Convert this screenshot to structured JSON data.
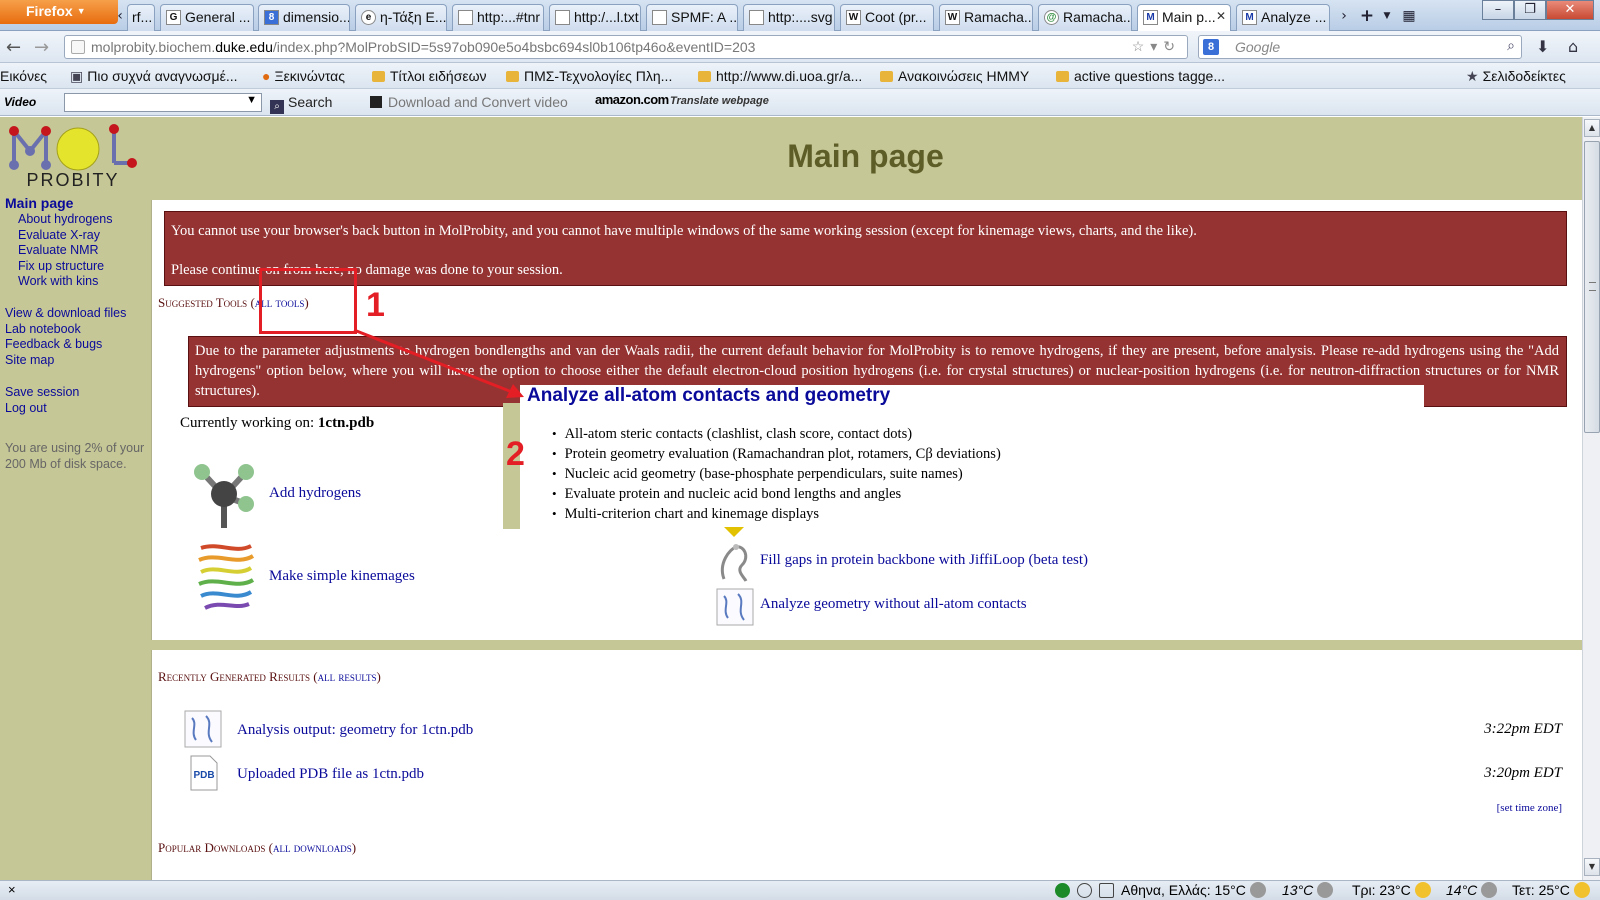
{
  "browser": {
    "app_button": "Firefox",
    "tabs": [
      {
        "label": "rf...",
        "icon": "K"
      },
      {
        "label": "General ...",
        "icon": "G"
      },
      {
        "label": "dimensio...",
        "icon": "8"
      },
      {
        "label": "η-Τάξη Ε...",
        "icon": "e"
      },
      {
        "label": "http:...#tnr",
        "icon": ""
      },
      {
        "label": "http:/...l.txt",
        "icon": ""
      },
      {
        "label": "SPMF: A ...",
        "icon": ""
      },
      {
        "label": "http:....svg",
        "icon": ""
      },
      {
        "label": "Coot (pr...",
        "icon": "W"
      },
      {
        "label": "Ramacha...",
        "icon": "W"
      },
      {
        "label": "Ramacha...",
        "icon": "@"
      },
      {
        "label": "Main p...",
        "icon": "M"
      },
      {
        "label": "Analyze ...",
        "icon": "M"
      }
    ],
    "new_tab": "+",
    "url_prefix": "molprobity.biochem.",
    "url_domain": "duke.edu",
    "url_suffix": "/index.php?MolProbSID=5s97ob090e5o4bsbc694sl0b106tp46o&eventID=203",
    "search_placeholder": "Google",
    "search_engine_icon": "8",
    "bookmarks": [
      "Εικόνες",
      "Πιο συχνά αναγνωσμέ...",
      "Ξεκινώντας",
      "Τίτλοι ειδήσεων",
      "ΠΜΣ-Τεχνολογίες Πλη...",
      "http://www.di.uoa.gr/a...",
      "Ανακοινώσεις ΗΜΜΥ",
      "active questions tagge..."
    ],
    "bookmarks_menu": "Σελιδοδείκτες",
    "video_label": "Video",
    "video_search": "Search",
    "video_download": "Download and Convert video",
    "amazon": "amazon.com",
    "translate": "Translate webpage"
  },
  "sidebar": {
    "logo_text": "PROBITY",
    "items": [
      {
        "label": "Main page",
        "main": true
      },
      {
        "label": "About hydrogens"
      },
      {
        "label": "Evaluate X-ray"
      },
      {
        "label": "Evaluate NMR"
      },
      {
        "label": "Fix up structure"
      },
      {
        "label": "Work with kins"
      },
      {
        "label": "View & download files"
      },
      {
        "label": "Lab notebook"
      },
      {
        "label": "Feedback & bugs"
      },
      {
        "label": "Site map"
      },
      {
        "label": "Save session"
      },
      {
        "label": "Log out"
      }
    ],
    "disk_note": "You are using 2% of your 200 Mb of disk space."
  },
  "page": {
    "title": "Main page",
    "alert_back_1": "You cannot use your browser's back button in MolProbity, and you cannot have multiple windows of the same working session (except for kinemage views, charts, and the like).",
    "alert_back_2": "Please continue on from here, no damage was done to your session.",
    "suggested_tools": "Suggested Tools",
    "all_tools": "all tools",
    "alert_hydrogens": "Due to the parameter adjustments to hydrogen bondlengths and van der Waals radii, the current default behavior for MolProbity is to remove hydrogens, if they are present, before analysis. Please re-add hydrogens using the \"Add hydrogens\" option below, where you will have the option to choose either the default electron-cloud position hydrogens (i.e. for crystal structures) or nuclear-position hydrogens (i.e. for neutron-diffraction structures or for NMR structures).",
    "working_label": "Currently working on:",
    "working_file": "1ctn.pdb",
    "tools": {
      "add_hydrogens": "Add hydrogens",
      "make_kinemages": "Make simple kinemages",
      "jiffiloop": "Fill gaps in protein backbone with JiffiLoop (beta test)",
      "geometry_only": "Analyze geometry without all-atom contacts"
    },
    "popup": {
      "title": "Analyze all-atom contacts and geometry",
      "items": [
        "All-atom steric contacts (clashlist, clash score, contact dots)",
        "Protein geometry evaluation (Ramachandran plot, rotamers, Cβ deviations)",
        "Nucleic acid geometry (base-phosphate perpendiculars, suite names)",
        "Evaluate protein and nucleic acid bond lengths and angles",
        "Multi-criterion chart and kinemage displays"
      ]
    },
    "recent_results": "Recently Generated Results",
    "all_results": "all results",
    "results": [
      {
        "label": "Analysis output: geometry for 1ctn.pdb",
        "time": "3:22pm EDT"
      },
      {
        "label": "Uploaded PDB file as 1ctn.pdb",
        "time": "3:20pm EDT"
      }
    ],
    "set_time_zone": "[set time zone]",
    "popular_downloads": "Popular Downloads",
    "all_downloads": "all downloads",
    "pdb_icon_text": "PDB"
  },
  "annotations": {
    "num1": "1",
    "num2": "2",
    "color": "#e31e24"
  },
  "status": {
    "close": "×",
    "weather": [
      {
        "text": "Αθηνα, Ελλάς: 15°C",
        "icon": "moon"
      },
      {
        "text": "13°C",
        "icon": "moon",
        "italic": true
      },
      {
        "text": "Τρι: 23°C",
        "icon": "sun"
      },
      {
        "text": "14°C",
        "icon": "moon",
        "italic": true
      },
      {
        "text": "Τετ: 25°C",
        "icon": "sun"
      }
    ]
  },
  "colors": {
    "sidebar_bg": "#c6c796",
    "link": "#0a0a9a",
    "alert_bg": "#953333",
    "title": "#5d5d27"
  }
}
